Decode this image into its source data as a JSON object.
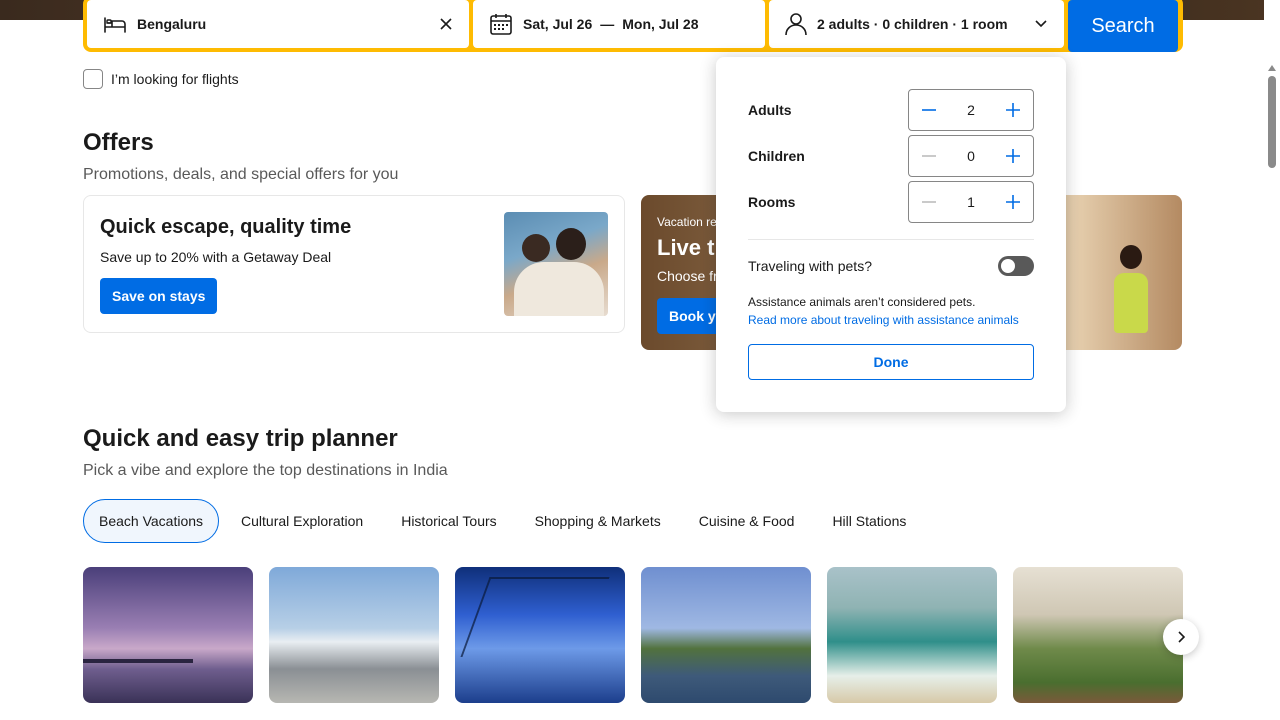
{
  "search": {
    "destination": "Bengaluru",
    "checkin": "Sat, Jul 26",
    "dash": "—",
    "checkout": "Mon, Jul 28",
    "guests": "2 adults · 0 children · 1 room",
    "search_label": "Search",
    "flights_label": "I’m looking for flights"
  },
  "offers": {
    "title": "Offers",
    "subtitle": "Promotions, deals, and special offers for you",
    "card1": {
      "title": "Quick escape, quality time",
      "desc": "Save up to 20% with a Getaway Deal",
      "button": "Save on stays"
    },
    "card2": {
      "eyebrow": "Vacation re",
      "title": "Live th",
      "desc": "Choose fr",
      "button": "Book yo"
    }
  },
  "guests_popup": {
    "adults_label": "Adults",
    "adults_value": "2",
    "children_label": "Children",
    "children_value": "0",
    "rooms_label": "Rooms",
    "rooms_value": "1",
    "pets_label": "Traveling with pets?",
    "pets_on": false,
    "note": "Assistance animals aren’t considered pets.",
    "link": "Read more about traveling with assistance animals",
    "done_label": "Done"
  },
  "planner": {
    "title": "Quick and easy trip planner",
    "subtitle": "Pick a vibe and explore the top destinations in India",
    "tabs": [
      {
        "label": "Beach Vacations",
        "active": true
      },
      {
        "label": "Cultural Exploration",
        "active": false
      },
      {
        "label": "Historical Tours",
        "active": false
      },
      {
        "label": "Shopping & Markets",
        "active": false
      },
      {
        "label": "Cuisine & Food",
        "active": false
      },
      {
        "label": "Hill Stations",
        "active": false
      }
    ]
  },
  "colors": {
    "brand_blue": "#006ce4",
    "search_yellow": "#febb02"
  },
  "icons": [
    "bed-icon",
    "clear-icon",
    "calendar-icon",
    "person-icon",
    "chevron-down-icon",
    "minus-icon",
    "plus-icon",
    "chevron-right-icon"
  ]
}
